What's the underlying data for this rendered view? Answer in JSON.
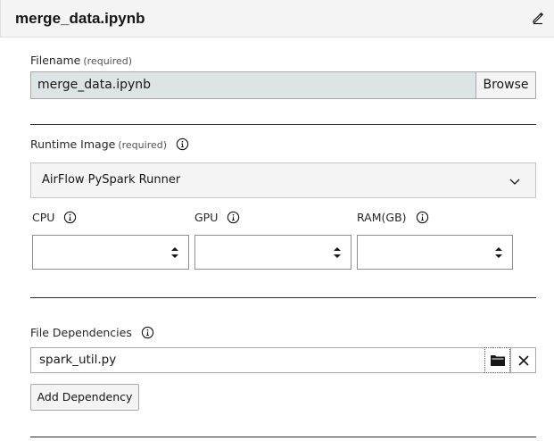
{
  "header": {
    "title": "merge_data.ipynb",
    "edit_icon": "pencil-icon"
  },
  "filename": {
    "label": "Filename",
    "required": "(required)",
    "value": "merge_data.ipynb",
    "browse_label": "Browse"
  },
  "runtime_image": {
    "label": "Runtime Image",
    "required": "(required)",
    "info_icon": "info-icon",
    "selected": "AirFlow PySpark Runner",
    "chevron_icon": "chevron-down-icon"
  },
  "resources": {
    "cpu": {
      "label": "CPU",
      "value": ""
    },
    "gpu": {
      "label": "GPU",
      "value": ""
    },
    "ram": {
      "label": "RAM(GB)",
      "value": ""
    }
  },
  "file_dependencies": {
    "label": "File Dependencies",
    "items": [
      "spark_util.py"
    ],
    "folder_icon": "folder-icon",
    "clear_icon": "close-icon",
    "add_label": "Add Dependency"
  },
  "colors": {
    "header_bg": "#f4f4f4",
    "readonly_input_bg": "#dde4e6",
    "divider": "#2b2b2b",
    "select_bg": "#f4f4f4"
  }
}
